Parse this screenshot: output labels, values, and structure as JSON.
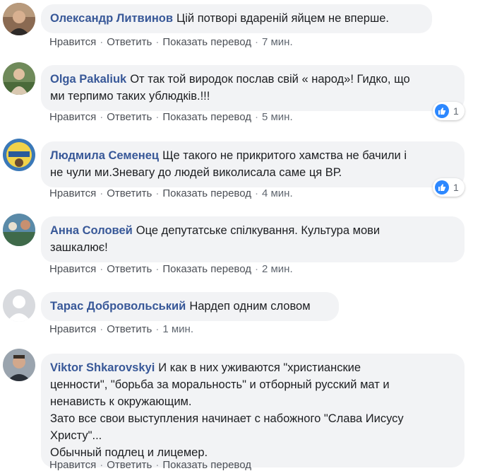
{
  "actions": {
    "like": "Нравится",
    "reply": "Ответить",
    "translate": "Показать перевод"
  },
  "comments": [
    {
      "author": "Олександр Литвинов",
      "lines": [
        "Цій потворі вдареній яйцем не вперше."
      ],
      "time": "7 мин.",
      "reactions": null,
      "avatar_icon": "user-photo"
    },
    {
      "author": "Olga Pakaliuk",
      "lines": [
        "От так той виродок послав свій « народ»! Гидко, що",
        "ми терпимо таких ублюдків.!!!"
      ],
      "time": "5 мин.",
      "reactions": "1",
      "avatar_icon": "user-photo"
    },
    {
      "author": "Людмила Семенец",
      "lines": [
        "Ще такого не прикритого хамства не бачили і",
        "не чули ми.Зневагу до людей виколисала саме ця ВР."
      ],
      "time": "4 мин.",
      "reactions": "1",
      "avatar_icon": "user-photo"
    },
    {
      "author": "Анна Соловей",
      "lines": [
        "Оце депутатське спілкування. Культура мови",
        "зашкалює!"
      ],
      "time": "2 мин.",
      "reactions": null,
      "avatar_icon": "user-photo"
    },
    {
      "author": "Тарас Добровольський",
      "lines": [
        "Нардеп одним словом"
      ],
      "time": "1 мин.",
      "reactions": null,
      "avatar_icon": "default-avatar"
    },
    {
      "author": "Viktor Shkarovskyi",
      "lines": [
        "И как в них уживаются \"христианские",
        "ценности\", \"борьба за моральность\" и отборный русский мат и",
        "ненависть к окружающим.",
        "Зато все свои выступления начинает с набожного \"Слава Иисусу",
        "Христу\"...",
        "Обычный подлец и лицемер."
      ],
      "time": "",
      "reactions": null,
      "avatar_icon": "user-photo"
    }
  ],
  "colors": {
    "author": "#385898",
    "bubble": "#f2f3f5",
    "like_badge": "#2d88ff"
  }
}
